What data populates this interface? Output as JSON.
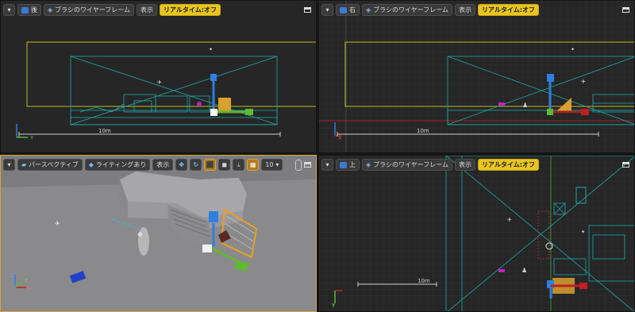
{
  "viewports": {
    "back": {
      "view_label": "後",
      "mode_label": "ブラシのワイヤーフレーム",
      "show_label": "表示",
      "realtime_label": "リアルタイム:オフ",
      "scale_label": "10m"
    },
    "right": {
      "view_label": "右",
      "mode_label": "ブラシのワイヤーフレーム",
      "show_label": "表示",
      "realtime_label": "リアルタイム:オフ",
      "scale_label": "10m"
    },
    "perspective": {
      "view_label": "パースペクティブ",
      "lighting_label": "ライティングあり",
      "show_label": "表示",
      "snap_value": "10"
    },
    "top": {
      "view_label": "上",
      "mode_label": "ブラシのワイヤーフレーム",
      "show_label": "表示",
      "realtime_label": "リアルタイム:オフ",
      "scale_label": "10m"
    }
  },
  "axis_labels": {
    "x": "X",
    "y": "Y",
    "z": "Z"
  },
  "colors": {
    "accent": "#e8c520",
    "selected_border": "#d8a535",
    "wire": "#1fa8a8",
    "bounds": "#b9b923",
    "grid": "#333333"
  }
}
